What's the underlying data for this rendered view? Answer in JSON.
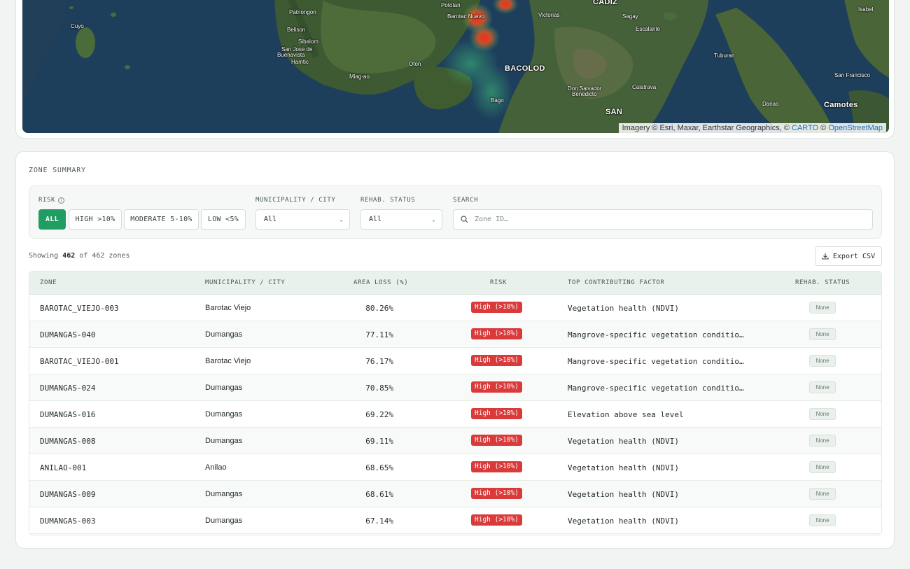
{
  "map": {
    "labels": [
      {
        "name": "Cuyo",
        "cls": ""
      },
      {
        "name": "Patnongon",
        "cls": ""
      },
      {
        "name": "Belison",
        "cls": ""
      },
      {
        "name": "Sibalom",
        "cls": ""
      },
      {
        "name": "San Jose de",
        "cls": ""
      },
      {
        "name": "Buenavista",
        "cls": ""
      },
      {
        "name": "Hamtic",
        "cls": ""
      },
      {
        "name": "Miag-ao",
        "cls": ""
      },
      {
        "name": "Oton",
        "cls": ""
      },
      {
        "name": "Pototan",
        "cls": ""
      },
      {
        "name": "Barotac Nuevo",
        "cls": ""
      },
      {
        "name": "Victorias",
        "cls": ""
      },
      {
        "name": "CADIZ",
        "cls": "big"
      },
      {
        "name": "Sagay",
        "cls": ""
      },
      {
        "name": "Escalante",
        "cls": ""
      },
      {
        "name": "BACOLOD",
        "cls": "big"
      },
      {
        "name": "Bago",
        "cls": ""
      },
      {
        "name": "Don Salvador",
        "cls": ""
      },
      {
        "name": "Benedicto",
        "cls": ""
      },
      {
        "name": "Calatrava",
        "cls": ""
      },
      {
        "name": "Tuburan",
        "cls": ""
      },
      {
        "name": "San Francisco",
        "cls": ""
      },
      {
        "name": "Isabel",
        "cls": ""
      },
      {
        "name": "Danao",
        "cls": ""
      },
      {
        "name": "Camotes",
        "cls": "big"
      },
      {
        "name": "SAN",
        "cls": "big"
      }
    ],
    "attribution": {
      "prefix": "Imagery © Esri, Maxar, Earthstar Geographics, © ",
      "carto": "CARTO",
      "sep": " © ",
      "osm": "OpenStreetMap"
    }
  },
  "summary": {
    "title": "ZONE SUMMARY",
    "filters": {
      "risk_label": "RISK",
      "risk_options": [
        "ALL",
        "HIGH >10%",
        "MODERATE 5-10%",
        "LOW <5%"
      ],
      "municipality_label": "MUNICIPALITY / CITY",
      "municipality_value": "All",
      "rehab_label": "REHAB. STATUS",
      "rehab_value": "All",
      "search_label": "SEARCH",
      "search_placeholder": "Zone ID…"
    },
    "showing": {
      "prefix": "Showing ",
      "count": "462",
      "suffix": " of 462 zones"
    },
    "export_label": "Export CSV",
    "columns": [
      "ZONE",
      "MUNICIPALITY / CITY",
      "AREA LOSS (%)",
      "RISK",
      "TOP CONTRIBUTING FACTOR",
      "REHAB. STATUS"
    ],
    "rows": [
      {
        "zone": "BAROTAC_VIEJO-003",
        "municipality": "Barotac Viejo",
        "area_loss": "80.26%",
        "risk": "High (>10%)",
        "factor": "Vegetation health (NDVI)",
        "status": "None"
      },
      {
        "zone": "DUMANGAS-040",
        "municipality": "Dumangas",
        "area_loss": "77.11%",
        "risk": "High (>10%)",
        "factor": "Mangrove-specific vegetation conditio…",
        "status": "None"
      },
      {
        "zone": "BAROTAC_VIEJO-001",
        "municipality": "Barotac Viejo",
        "area_loss": "76.17%",
        "risk": "High (>10%)",
        "factor": "Mangrove-specific vegetation conditio…",
        "status": "None"
      },
      {
        "zone": "DUMANGAS-024",
        "municipality": "Dumangas",
        "area_loss": "70.85%",
        "risk": "High (>10%)",
        "factor": "Mangrove-specific vegetation conditio…",
        "status": "None"
      },
      {
        "zone": "DUMANGAS-016",
        "municipality": "Dumangas",
        "area_loss": "69.22%",
        "risk": "High (>10%)",
        "factor": "Elevation above sea level",
        "status": "None"
      },
      {
        "zone": "DUMANGAS-008",
        "municipality": "Dumangas",
        "area_loss": "69.11%",
        "risk": "High (>10%)",
        "factor": "Vegetation health (NDVI)",
        "status": "None"
      },
      {
        "zone": "ANILAO-001",
        "municipality": "Anilao",
        "area_loss": "68.65%",
        "risk": "High (>10%)",
        "factor": "Vegetation health (NDVI)",
        "status": "None"
      },
      {
        "zone": "DUMANGAS-009",
        "municipality": "Dumangas",
        "area_loss": "68.61%",
        "risk": "High (>10%)",
        "factor": "Vegetation health (NDVI)",
        "status": "None"
      },
      {
        "zone": "DUMANGAS-003",
        "municipality": "Dumangas",
        "area_loss": "67.14%",
        "risk": "High (>10%)",
        "factor": "Vegetation health (NDVI)",
        "status": "None"
      }
    ]
  },
  "colors": {
    "accent": "#1f9d62",
    "high_risk": "#d93a3a"
  }
}
